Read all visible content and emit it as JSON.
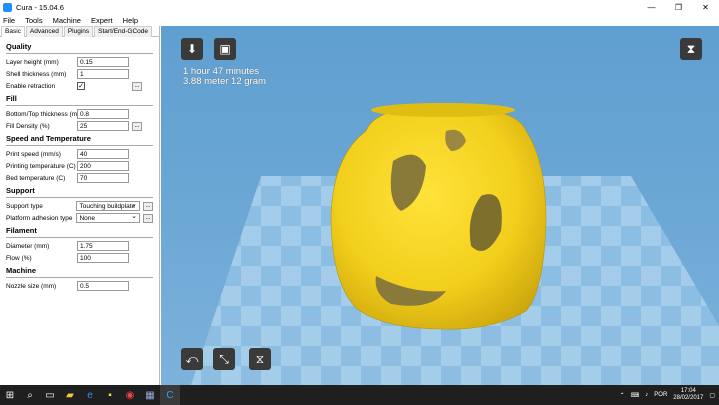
{
  "window": {
    "title": "Cura - 15.04.6"
  },
  "menu": [
    "File",
    "Tools",
    "Machine",
    "Expert",
    "Help"
  ],
  "tabs": [
    "Basic",
    "Advanced",
    "Plugins",
    "Start/End-GCode"
  ],
  "quality": {
    "title": "Quality",
    "layer_height_label": "Layer height (mm)",
    "layer_height": "0.15",
    "shell_label": "Shell thickness (mm)",
    "shell": "1",
    "retraction_label": "Enable retraction",
    "retraction_check": "✓"
  },
  "fill": {
    "title": "Fill",
    "bottom_top_label": "Bottom/Top thickness (mm)",
    "bottom_top": "0.8",
    "density_label": "Fill Density (%)",
    "density": "25"
  },
  "speed": {
    "title": "Speed and Temperature",
    "print_speed_label": "Print speed (mm/s)",
    "print_speed": "40",
    "print_temp_label": "Printing temperature (C)",
    "print_temp": "200",
    "bed_temp_label": "Bed temperature (C)",
    "bed_temp": "70"
  },
  "support": {
    "title": "Support",
    "type_label": "Support type",
    "type": "Touching buildplate",
    "adhesion_label": "Platform adhesion type",
    "adhesion": "None"
  },
  "filament": {
    "title": "Filament",
    "diameter_label": "Diameter (mm)",
    "diameter": "1.75",
    "flow_label": "Flow (%)",
    "flow": "100"
  },
  "machine": {
    "title": "Machine",
    "nozzle_label": "Nozzle size (mm)",
    "nozzle": "0.5"
  },
  "dots": "...",
  "estimate": {
    "line1": "1 hour 47 minutes",
    "line2": "3.88 meter 12 gram"
  },
  "tray": {
    "lang": "POR",
    "time": "17:04",
    "date": "28/02/2017"
  },
  "colors": {
    "model": "#f2cf1c",
    "viewport": "#6aa6d4"
  }
}
